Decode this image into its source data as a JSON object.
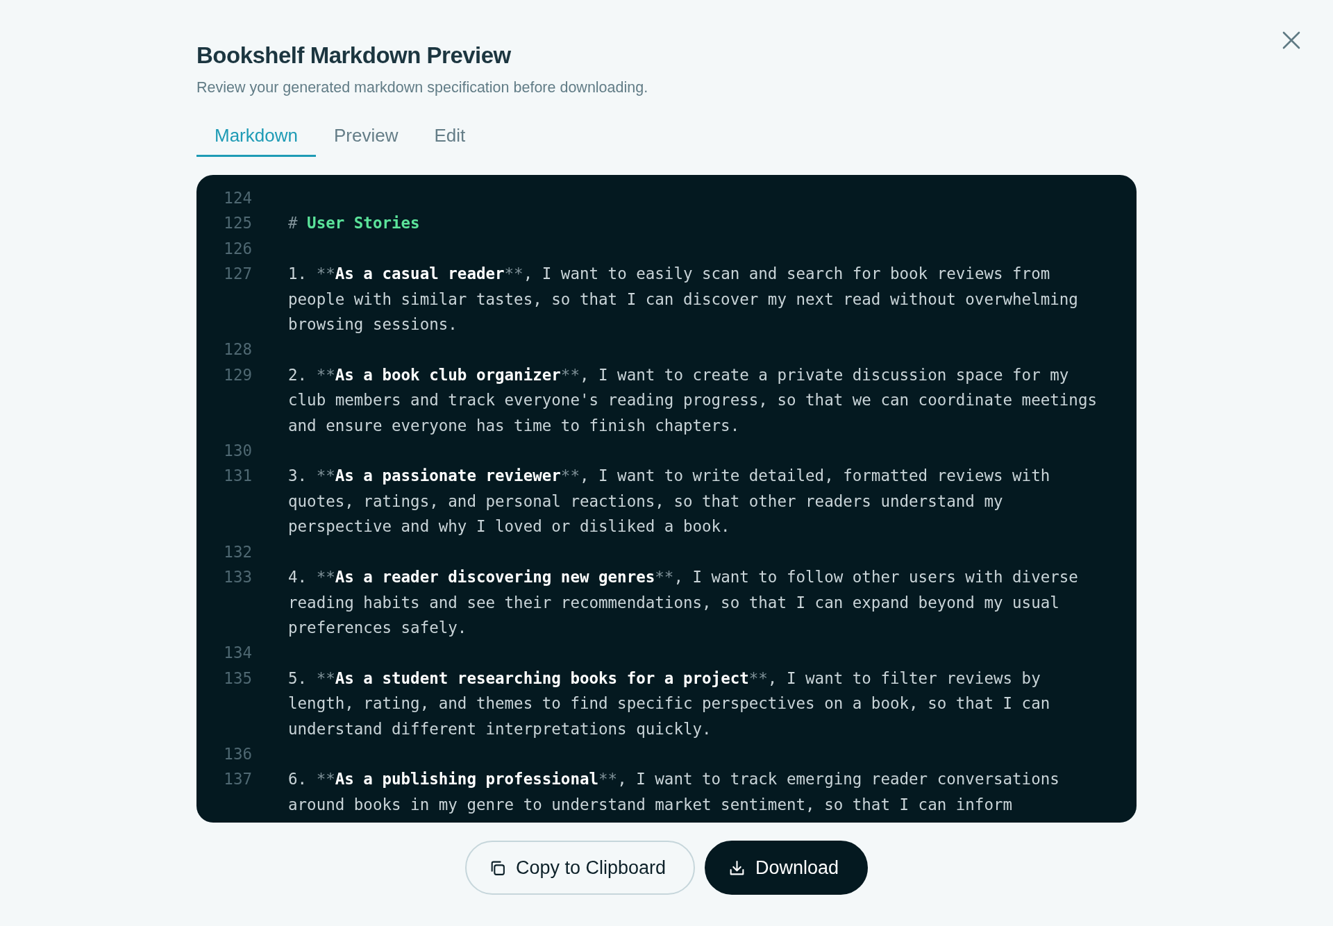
{
  "dialog": {
    "title": "Bookshelf Markdown Preview",
    "subtitle": "Review your generated markdown specification before downloading."
  },
  "tabs": [
    {
      "label": "Markdown",
      "selected": true
    },
    {
      "label": "Preview",
      "selected": false
    },
    {
      "label": "Edit",
      "selected": false
    }
  ],
  "editor": {
    "lines": [
      {
        "number": "124"
      },
      {
        "number": "125",
        "rows": [
          [
            {
              "text": "# ",
              "kind": "mark"
            },
            {
              "text": "User Stories",
              "kind": "heading"
            }
          ]
        ]
      },
      {
        "number": "126"
      },
      {
        "number": "127",
        "rows": [
          [
            {
              "text": "1. ",
              "kind": "plain"
            },
            {
              "text": "**",
              "kind": "mark"
            },
            {
              "text": "As a casual reader",
              "kind": "bold"
            },
            {
              "text": "**",
              "kind": "mark"
            },
            {
              "text": ", I want to easily scan and search for book reviews from",
              "kind": "plain"
            }
          ],
          [
            {
              "text": "people with similar tastes, so that I can discover my next read without overwhelming",
              "kind": "plain"
            }
          ],
          [
            {
              "text": "browsing sessions.",
              "kind": "plain"
            }
          ]
        ]
      },
      {
        "number": "128"
      },
      {
        "number": "129",
        "rows": [
          [
            {
              "text": "2. ",
              "kind": "plain"
            },
            {
              "text": "**",
              "kind": "mark"
            },
            {
              "text": "As a book club organizer",
              "kind": "bold"
            },
            {
              "text": "**",
              "kind": "mark"
            },
            {
              "text": ", I want to create a private discussion space for my",
              "kind": "plain"
            }
          ],
          [
            {
              "text": "club members and track everyone's reading progress, so that we can coordinate meetings",
              "kind": "plain"
            }
          ],
          [
            {
              "text": "and ensure everyone has time to finish chapters.",
              "kind": "plain"
            }
          ]
        ]
      },
      {
        "number": "130"
      },
      {
        "number": "131",
        "rows": [
          [
            {
              "text": "3. ",
              "kind": "plain"
            },
            {
              "text": "**",
              "kind": "mark"
            },
            {
              "text": "As a passionate reviewer",
              "kind": "bold"
            },
            {
              "text": "**",
              "kind": "mark"
            },
            {
              "text": ", I want to write detailed, formatted reviews with",
              "kind": "plain"
            }
          ],
          [
            {
              "text": "quotes, ratings, and personal reactions, so that other readers understand my",
              "kind": "plain"
            }
          ],
          [
            {
              "text": "perspective and why I loved or disliked a book.",
              "kind": "plain"
            }
          ]
        ]
      },
      {
        "number": "132"
      },
      {
        "number": "133",
        "rows": [
          [
            {
              "text": "4. ",
              "kind": "plain"
            },
            {
              "text": "**",
              "kind": "mark"
            },
            {
              "text": "As a reader discovering new genres",
              "kind": "bold"
            },
            {
              "text": "**",
              "kind": "mark"
            },
            {
              "text": ", I want to follow other users with diverse",
              "kind": "plain"
            }
          ],
          [
            {
              "text": "reading habits and see their recommendations, so that I can expand beyond my usual",
              "kind": "plain"
            }
          ],
          [
            {
              "text": "preferences safely.",
              "kind": "plain"
            }
          ]
        ]
      },
      {
        "number": "134"
      },
      {
        "number": "135",
        "rows": [
          [
            {
              "text": "5. ",
              "kind": "plain"
            },
            {
              "text": "**",
              "kind": "mark"
            },
            {
              "text": "As a student researching books for a project",
              "kind": "bold"
            },
            {
              "text": "**",
              "kind": "mark"
            },
            {
              "text": ", I want to filter reviews by",
              "kind": "plain"
            }
          ],
          [
            {
              "text": "length, rating, and themes to find specific perspectives on a book, so that I can",
              "kind": "plain"
            }
          ],
          [
            {
              "text": "understand different interpretations quickly.",
              "kind": "plain"
            }
          ]
        ]
      },
      {
        "number": "136"
      },
      {
        "number": "137",
        "rows": [
          [
            {
              "text": "6. ",
              "kind": "plain"
            },
            {
              "text": "**",
              "kind": "mark"
            },
            {
              "text": "As a publishing professional",
              "kind": "bold"
            },
            {
              "text": "**",
              "kind": "mark"
            },
            {
              "text": ", I want to track emerging reader conversations",
              "kind": "plain"
            }
          ],
          [
            {
              "text": "around books in my genre to understand market sentiment, so that I can inform",
              "kind": "plain"
            }
          ]
        ]
      }
    ]
  },
  "buttons": [
    {
      "label": "Copy to Clipboard",
      "kind": "secondary"
    },
    {
      "label": "Download",
      "kind": "primary"
    }
  ]
}
